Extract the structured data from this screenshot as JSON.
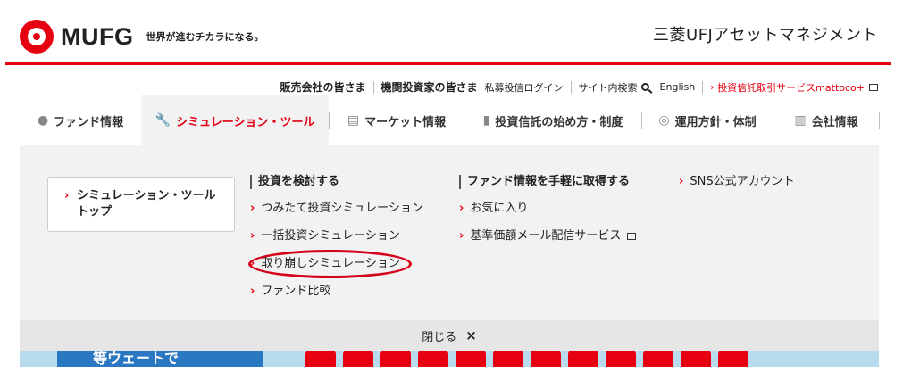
{
  "header": {
    "logo_text": "MUFG",
    "tagline": "世界が進むチカラになる。",
    "company": "三菱UFJアセットマネジメント"
  },
  "util_nav": {
    "sales": "販売会社の皆さま",
    "institutional": "機関投資家の皆さま",
    "private_login": "私募投信ログイン",
    "site_search": "サイト内検索",
    "english": "English",
    "mattoco": "投資信託取引サービスmattoco+"
  },
  "main_nav": {
    "items": [
      {
        "label": "ファンド情報",
        "icon": "yen-circle-icon"
      },
      {
        "label": "シミュレーション・ツール",
        "icon": "wrench-icon"
      },
      {
        "label": "マーケット情報",
        "icon": "document-icon"
      },
      {
        "label": "投資信託の始め方・制度",
        "icon": "book-icon"
      },
      {
        "label": "運用方針・体制",
        "icon": "compass-icon"
      },
      {
        "label": "会社情報",
        "icon": "building-icon"
      }
    ]
  },
  "panel": {
    "top_link": "シミュレーション・ツールトップ",
    "col1": {
      "heading": "投資を検討する",
      "links": [
        "つみたて投資シミュレーション",
        "一括投資シミュレーション",
        "取り崩しシミュレーション",
        "ファンド比較"
      ]
    },
    "col2": {
      "heading": "ファンド情報を手軽に取得する",
      "links": [
        "お気に入り",
        "基準価額メール配信サービス"
      ]
    },
    "col3": {
      "link": "SNS公式アカウント"
    },
    "close_label": "閉じる",
    "close_icon": "×"
  },
  "banner": {
    "left_text": "等ウェートで"
  },
  "colors": {
    "brand_red": "#e60012",
    "panel_bg": "#f2f2f2",
    "close_bar_bg": "#e6e6e6"
  }
}
